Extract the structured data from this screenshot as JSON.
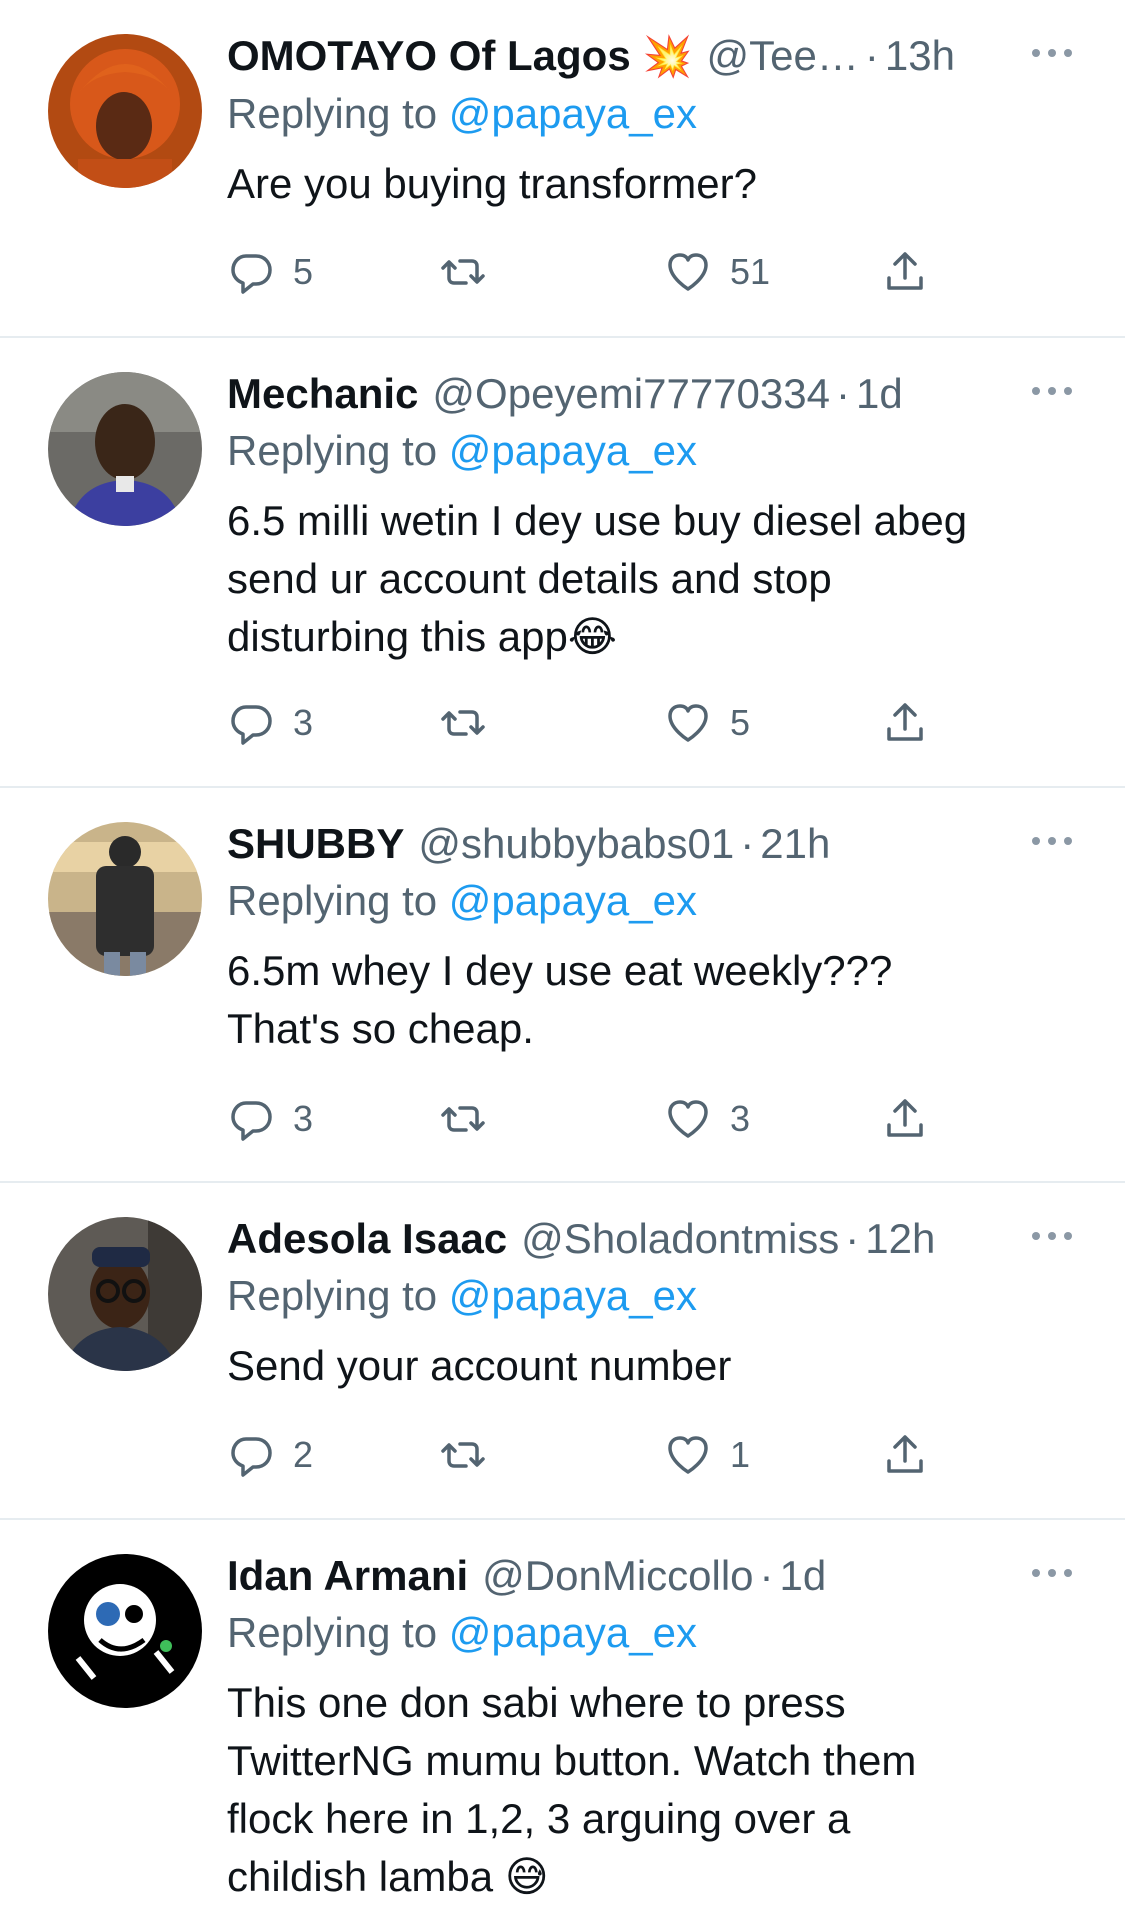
{
  "tweets": [
    {
      "name": "OMOTAYO Of Lagos",
      "badge": "💥",
      "handle": "@Tee…",
      "sep": "·",
      "time": "13h",
      "replying_prefix": "Replying to",
      "replying_to": "@papaya_ex",
      "text": "Are you buying transformer?",
      "emoji": "",
      "reply_count": "5",
      "like_count": "51"
    },
    {
      "name": "Mechanic",
      "handle": "@Opeyemi77770334",
      "sep": "·",
      "time": "1d",
      "replying_prefix": "Replying to",
      "replying_to": "@papaya_ex",
      "text": "6.5 milli wetin I dey use buy diesel abeg\nsend ur account details and stop\ndisturbing this app",
      "emoji": "😂",
      "reply_count": "3",
      "like_count": "5"
    },
    {
      "name": "SHUBBY",
      "handle": "@shubbybabs01",
      "sep": "·",
      "time": "21h",
      "replying_prefix": "Replying to",
      "replying_to": "@papaya_ex",
      "text": "6.5m whey I dey use eat weekly???\nThat's so cheap.",
      "emoji": "",
      "reply_count": "3",
      "like_count": "3"
    },
    {
      "name": "Adesola Isaac",
      "handle": "@Sholadontmiss",
      "sep": "·",
      "time": "12h",
      "replying_prefix": "Replying to",
      "replying_to": "@papaya_ex",
      "text": "Send your account number",
      "emoji": "",
      "reply_count": "2",
      "like_count": "1"
    },
    {
      "name": "Idan Armani",
      "handle": "@DonMiccollo",
      "sep": "·",
      "time": "1d",
      "replying_prefix": "Replying to",
      "replying_to": "@papaya_ex",
      "text": "This one don sabi where to press\nTwitterNG mumu button. Watch them\nflock here in 1,2, 3 arguing over a\nchildish lamba ",
      "emoji": "😅",
      "reply_count": "",
      "like_count": ""
    }
  ],
  "colors": {
    "link": "#1d9bf0",
    "muted": "#536471",
    "divider": "#e6ecf0"
  },
  "icons": [
    "reply-icon",
    "retweet-icon",
    "like-icon",
    "share-icon",
    "more-icon"
  ]
}
